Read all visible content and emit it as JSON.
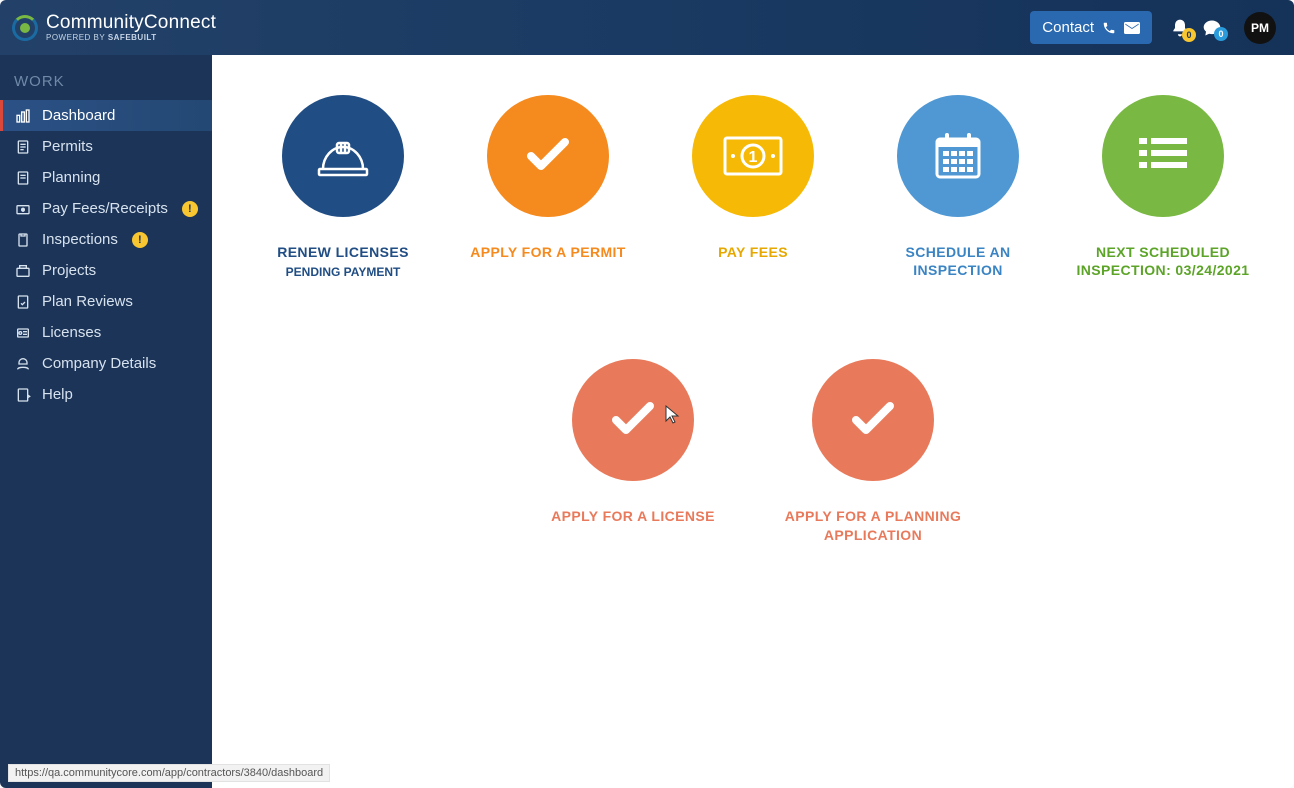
{
  "header": {
    "brand_title": "CommunityConnect",
    "brand_sub_prefix": "POWERED BY ",
    "brand_sub_bold": "SAFEbuilt",
    "contact_label": "Contact",
    "bell_badge": "0",
    "chat_badge": "0",
    "avatar_initials": "PM"
  },
  "sidebar": {
    "heading": "WORK",
    "items": [
      {
        "label": "Dashboard",
        "active": true,
        "badge": ""
      },
      {
        "label": "Permits",
        "active": false,
        "badge": ""
      },
      {
        "label": "Planning",
        "active": false,
        "badge": ""
      },
      {
        "label": "Pay Fees/Receipts",
        "active": false,
        "badge": "!"
      },
      {
        "label": "Inspections",
        "active": false,
        "badge": "!"
      },
      {
        "label": "Projects",
        "active": false,
        "badge": ""
      },
      {
        "label": "Plan Reviews",
        "active": false,
        "badge": ""
      },
      {
        "label": "Licenses",
        "active": false,
        "badge": ""
      },
      {
        "label": "Company Details",
        "active": false,
        "badge": ""
      },
      {
        "label": "Help",
        "active": false,
        "badge": ""
      }
    ]
  },
  "tiles_row1": [
    {
      "title": "RENEW LICENSES",
      "sub": "PENDING PAYMENT",
      "color": "blue",
      "icon": "hardhat"
    },
    {
      "title": "APPLY FOR A PERMIT",
      "sub": "",
      "color": "orange",
      "icon": "check"
    },
    {
      "title": "PAY FEES",
      "sub": "",
      "color": "yellow",
      "icon": "money"
    },
    {
      "title": "SCHEDULE AN INSPECTION",
      "sub": "",
      "color": "lblue",
      "icon": "calendar"
    },
    {
      "title": "NEXT SCHEDULED INSPECTION: 03/24/2021",
      "sub": "",
      "color": "green",
      "icon": "list"
    }
  ],
  "tiles_row2": [
    {
      "title": "APPLY FOR A LICENSE",
      "sub": "",
      "color": "salmon",
      "icon": "check"
    },
    {
      "title": "APPLY FOR A PLANNING APPLICATION",
      "sub": "",
      "color": "salmon",
      "icon": "check"
    }
  ],
  "status_url": "https://qa.communitycore.com/app/contractors/3840/dashboard"
}
